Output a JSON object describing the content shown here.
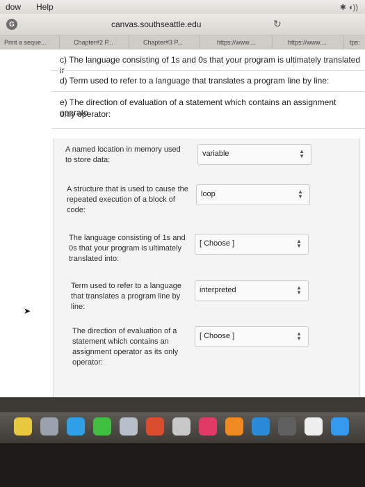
{
  "menubar": {
    "items": [
      "dow",
      "Help"
    ]
  },
  "browser": {
    "domain": "canvas.southseattle.edu",
    "tabs": [
      "Print a seque...",
      "Chapter#2 P...",
      "Chapter#3 P...",
      "https://www....",
      "https://www....",
      "tps:"
    ]
  },
  "questions": {
    "c": "c) The language consisting of 1s and 0s that your program is ultimately translated ir",
    "d": "d) Term used to refer to a language that translates a program line by line:",
    "e_line1": "e) The direction of evaluation of a statement which contains an assignment operato",
    "e_line2": "only operator:"
  },
  "matches": [
    {
      "lines": [
        "A named location in memory used",
        "to store data:"
      ],
      "value": "variable"
    },
    {
      "lines": [
        "A structure that is used to cause the",
        "repeated execution of a block of",
        "code:"
      ],
      "value": "loop"
    },
    {
      "lines": [
        "The language consisting of 1s and",
        "0s that your program is ultimately",
        "translated into:"
      ],
      "value": "[ Choose ]"
    },
    {
      "lines": [
        "Term used to refer to a language",
        "that translates a program line by",
        "line:"
      ],
      "value": "interpreted"
    },
    {
      "lines": [
        "The direction of evaluation of a",
        "statement which contains an",
        "assignment operator as its only",
        "operator:"
      ],
      "value": "[ Choose ]"
    }
  ],
  "icons": {
    "reload": "reload-icon",
    "select_arrows": "updown-arrows-icon",
    "browser": "google-g-icon"
  },
  "colors": {
    "dock_apps": [
      "#e7c940",
      "#9aa3ad",
      "#2fa0e8",
      "#3fbe3f",
      "#b7c0c8",
      "#d94d2e",
      "#c8c8c8",
      "#e23a66",
      "#f08a1e",
      "#2a8ad8",
      "#606060",
      "#eeeeee",
      "#3399ee"
    ]
  }
}
